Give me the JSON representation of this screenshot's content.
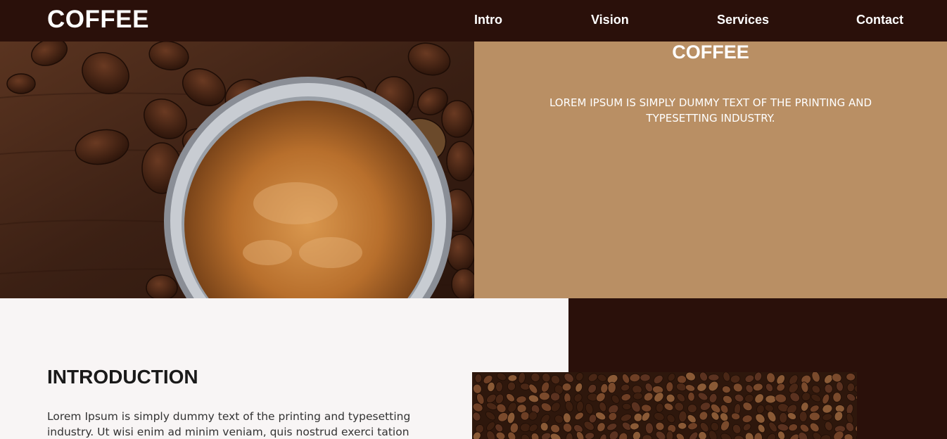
{
  "header": {
    "logo": "COFFEE",
    "nav": [
      {
        "label": "Intro"
      },
      {
        "label": "Vision"
      },
      {
        "label": "Services"
      },
      {
        "label": "Contact"
      }
    ]
  },
  "hero": {
    "title": "COFFEE",
    "text": "LOREM IPSUM IS SIMPLY DUMMY TEXT OF THE PRINTING AND TYPESETTING INDUSTRY."
  },
  "intro": {
    "title": "INTRODUCTION",
    "text": "Lorem Ipsum is simply dummy text of the printing and typesetting industry. Ut wisi enim ad minim veniam, quis nostrud exerci tation"
  },
  "colors": {
    "header_bg": "#2a100a",
    "hero_panel": "#b98f64",
    "page_bg": "#f8f5f5"
  }
}
